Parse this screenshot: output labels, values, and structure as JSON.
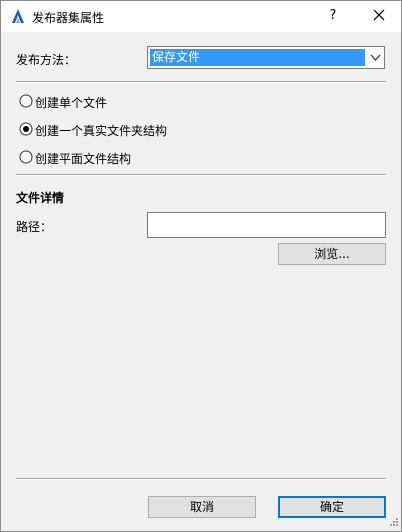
{
  "window": {
    "title": "发布器集属性"
  },
  "titlebar": {
    "help_label": "?"
  },
  "publish_method": {
    "label": "发布方法：",
    "value": "保存文件"
  },
  "options": [
    {
      "label": "创建单个文件",
      "selected": false
    },
    {
      "label": "创建一个真实文件夹结构",
      "selected": true
    },
    {
      "label": "创建平面文件结构",
      "selected": false
    }
  ],
  "file_details": {
    "heading": "文件详情",
    "path_label": "路径：",
    "path_value": "",
    "browse_label": "浏览..."
  },
  "footer": {
    "cancel_label": "取消",
    "ok_label": "确定"
  },
  "colors": {
    "selection": "#3399ff",
    "default_button_border": "#0078d7"
  }
}
